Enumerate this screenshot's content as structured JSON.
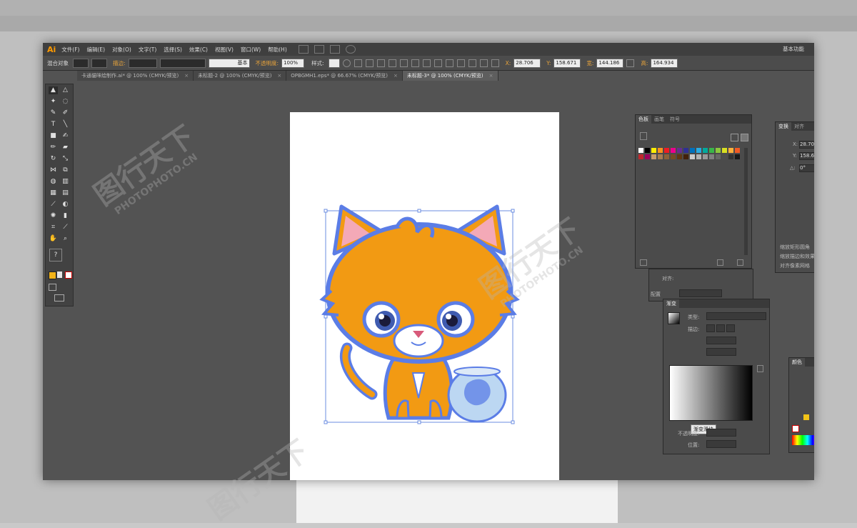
{
  "app": {
    "logo": "Ai",
    "menu": [
      "文件(F)",
      "编辑(E)",
      "对象(O)",
      "文字(T)",
      "选择(S)",
      "效果(C)",
      "视图(V)",
      "窗口(W)",
      "帮助(H)"
    ],
    "workspace": "基本功能"
  },
  "control_bar": {
    "selection_label": "混合对象",
    "stroke_label": "描边:",
    "stroke_style": "基本",
    "opacity_label": "不透明度:",
    "opacity_value": "100%",
    "style_label": "样式:",
    "x_label": "X:",
    "x_value": "28.706",
    "y_label": "Y:",
    "y_value": "158.671",
    "w_label": "宽:",
    "w_value": "144.186",
    "h_label": "高:",
    "h_value": "164.934"
  },
  "tabs": [
    {
      "label": "卡通貓咪绘制作.ai* @ 100% (CMYK/预览)"
    },
    {
      "label": "未标题-2 @ 100% (CMYK/预览)"
    },
    {
      "label": "OPBGMH1.eps* @ 66.67% (CMYK/预览)"
    },
    {
      "label": "未标题-3* @ 100% (CMYK/预览)"
    }
  ],
  "tab_close": "×",
  "swatches_panel": {
    "tabs": [
      "色板",
      "画笔",
      "符号"
    ],
    "colors": [
      "#ffffff",
      "#000000",
      "#ffee00",
      "#f7931e",
      "#ed1c24",
      "#ec008c",
      "#662d91",
      "#2e3192",
      "#0071bc",
      "#29abe2",
      "#00a99d",
      "#39b54a",
      "#8cc63f",
      "#d9e021",
      "#fbb03b",
      "#f15a24",
      "#c1272d",
      "#9e005d",
      "#c69c6d",
      "#a67c52",
      "#8c6239",
      "#754c24",
      "#603813",
      "#42210b",
      "#cccccc",
      "#b3b3b3",
      "#999999",
      "#808080",
      "#666666",
      "#4d4d4d",
      "#333333",
      "#1a1a1a"
    ]
  },
  "transform_panel": {
    "tabs": [
      "变换",
      "对齐"
    ],
    "x_label": "X:",
    "x_value": "28.70",
    "y_label": "Y:",
    "y_value": "158.6",
    "angle_label": "△:",
    "angle_value": "0°",
    "options": [
      "缩放矩形圆角",
      "缩放描边和效果",
      "对齐像素网格"
    ]
  },
  "align_panel": {
    "label": "对齐:",
    "label2": "配置"
  },
  "gradient_panel": {
    "title": "渐变",
    "type_label": "类型:",
    "stroke_label": "描边:",
    "tooltip": "渐变滑块",
    "opacity_label": "不透明度:",
    "location_label": "位置:"
  },
  "color_panel": {
    "title": "颜色"
  },
  "watermark": {
    "text": "图行天下",
    "subtext": "PHOTOPHOTO.CN"
  }
}
